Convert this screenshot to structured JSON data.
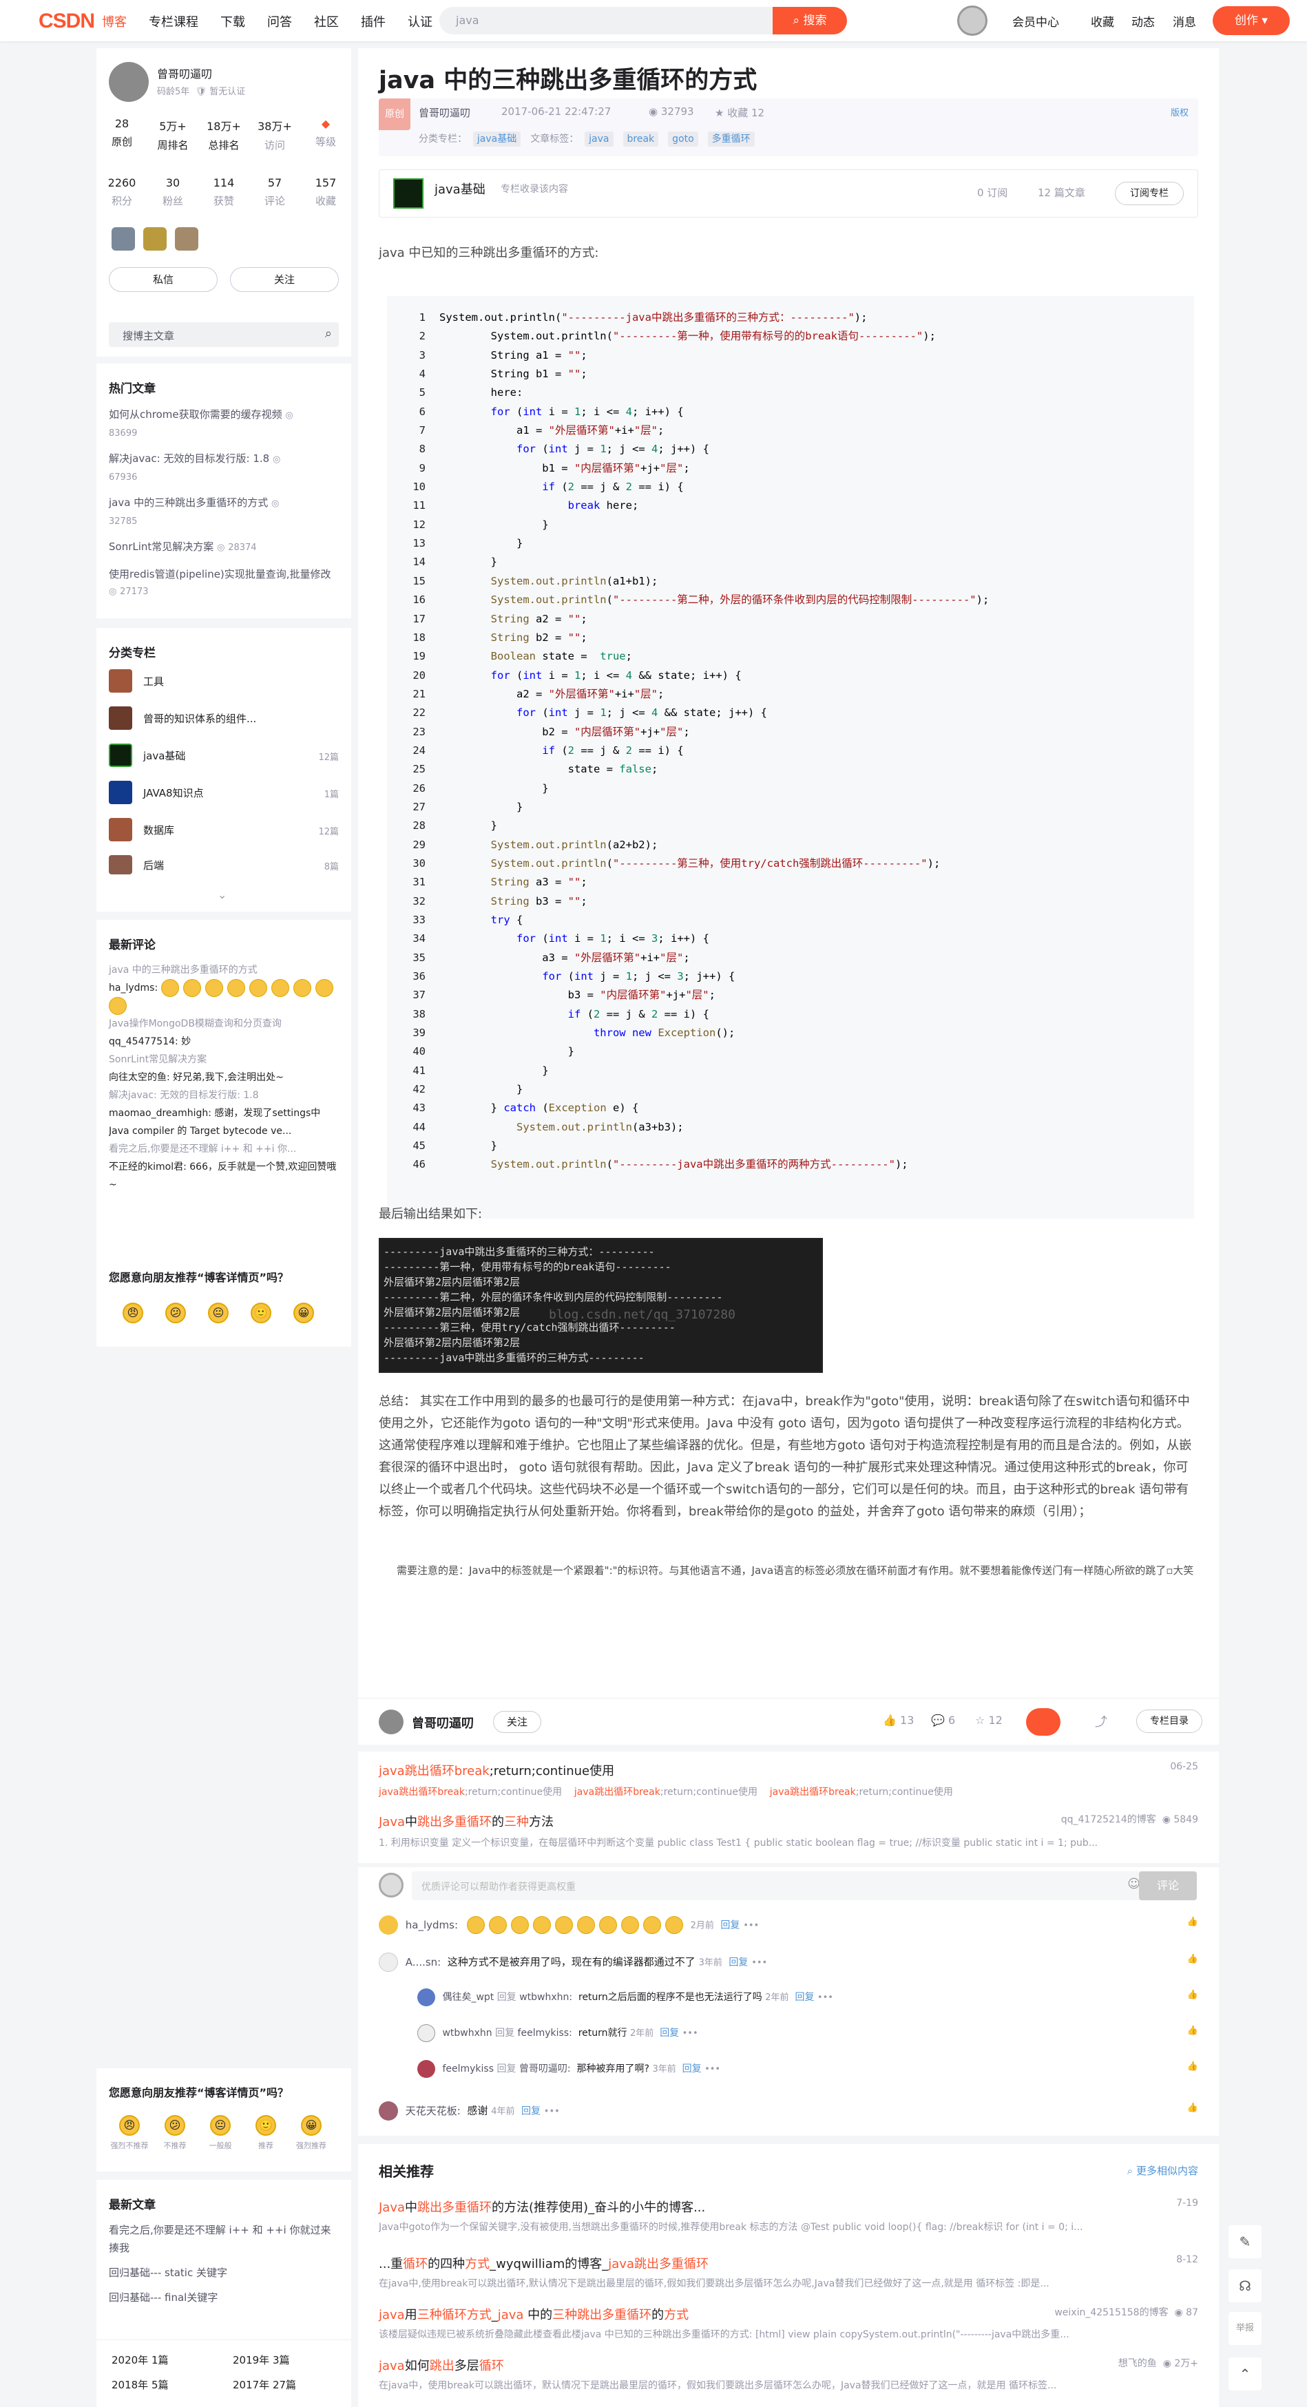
{
  "topbar": {
    "logo": "CSDN",
    "nav": [
      "博客",
      "专栏课程",
      "下载",
      "问答",
      "社区",
      "插件",
      "认证"
    ],
    "search_placeholder": "java",
    "search_button": "搜索",
    "right": [
      "会员中心",
      "收藏",
      "动态",
      "消息"
    ],
    "create_button": "创作"
  },
  "profile": {
    "name": "曾哥叨逼叨",
    "age": "码龄5年",
    "cert": "暂无认证",
    "stats1": [
      {
        "v": "28",
        "l": "原创"
      },
      {
        "v": "5万+",
        "l": "周排名"
      },
      {
        "v": "18万+",
        "l": "总排名"
      },
      {
        "v": "38万+",
        "l": "访问"
      },
      {
        "v": "",
        "l": "等级"
      }
    ],
    "stats2": [
      {
        "v": "2260",
        "l": "积分"
      },
      {
        "v": "30",
        "l": "粉丝"
      },
      {
        "v": "114",
        "l": "获赞"
      },
      {
        "v": "57",
        "l": "评论"
      },
      {
        "v": "157",
        "l": "收藏"
      }
    ],
    "msg_button": "私信",
    "follow_button": "关注",
    "search_placeholder": "搜博主文章"
  },
  "hot": {
    "title": "热门文章",
    "items": [
      {
        "t": "如何从chrome获取你需要的缓存视频",
        "v": "83699"
      },
      {
        "t": "解决javac: 无效的目标发行版: 1.8",
        "v": "67936"
      },
      {
        "t": "java 中的三种跳出多重循环的方式",
        "v": "32785"
      },
      {
        "t": "SonrLint常见解决方案",
        "v": "28374"
      },
      {
        "t": "使用redis管道(pipeline)实现批量查询,批量修改",
        "v": "27173"
      }
    ]
  },
  "categories": {
    "title": "分类专栏",
    "items": [
      {
        "n": "工具",
        "c": ""
      },
      {
        "n": "曾哥的知识体系的组件...",
        "c": ""
      },
      {
        "n": "java基础",
        "c": "12篇"
      },
      {
        "n": "JAVA8知识点",
        "c": "1篇"
      },
      {
        "n": "数据库",
        "c": "12篇"
      },
      {
        "n": "后端",
        "c": "8篇"
      }
    ]
  },
  "recent_comments": {
    "title": "最新评论",
    "items": [
      {
        "a": "java 中的三种跳出多重循环的方式",
        "b": "ha_lydms:"
      },
      {
        "a": "Java操作MongoDB模糊查询和分页查询",
        "b": "qq_45477514: 妙"
      },
      {
        "a": "SonrLint常见解决方案",
        "b": "向往太空的鱼: 好兄弟,我下,会注明出处~"
      },
      {
        "a": "解决javac: 无效的目标发行版: 1.8",
        "b": "maomao_dreamhigh: 感谢，发现了settings中Java compiler 的 Target bytecode ve..."
      },
      {
        "a": "看完之后,你要是还不理解 i++ 和 ++i 你...",
        "b": "不正经的kimol君: 666，反手就是一个赞,欢迎回赞哦~"
      }
    ]
  },
  "recommend_box": {
    "title": "您愿意向朋友推荐“博客详情页”吗？",
    "labels": [
      "强烈不推荐",
      "不推荐",
      "一般般",
      "推荐",
      "强烈推荐"
    ]
  },
  "recent_articles": {
    "title": "最新文章",
    "items": [
      "看完之后,你要是还不理解 i++ 和 ++i 你就过来揍我",
      "回归基础--- static 关键字",
      "回归基础--- final关键字"
    ],
    "archive": [
      {
        "y": "2020年",
        "n": "1篇"
      },
      {
        "y": "2019年",
        "n": "3篇"
      },
      {
        "y": "2018年",
        "n": "5篇"
      },
      {
        "y": "2017年",
        "n": "27篇"
      }
    ]
  },
  "article": {
    "title": "java 中的三种跳出多重循环的方式",
    "badge": "原创",
    "author": "曾哥叨逼叨",
    "date": "2017-06-21 22:47:27",
    "views": "32793",
    "fav": "收藏 12",
    "copyright": "版权",
    "cat_label": "分类专栏：",
    "cat": "java基础",
    "tag_label": "文章标签：",
    "tags": [
      "java",
      "break",
      "goto",
      "多重循环"
    ],
    "column_name": "java基础",
    "column_desc": "专栏收录该内容",
    "column_sub": "0 订阅",
    "column_count": "12 篇文章",
    "column_btn": "订阅专栏",
    "intro": "java 中已知的三种跳出多重循环的方式:",
    "output_label": "最后输出结果如下:",
    "console": [
      "---------java中跳出多重循环的三种方式：---------",
      "---------第一种，使用带有标号的的break语句---------",
      "外层循环第2层内层循环第2层",
      "---------第二种，外层的循环条件收到内层的代码控制限制---------",
      "外层循环第2层内层循环第2层",
      "---------第三种，使用try/catch强制跳出循环---------",
      "外层循环第2层内层循环第2层",
      "---------java中跳出多重循环的三种方式---------"
    ],
    "watermark": "blog.csdn.net/qq_37107280",
    "summary": "总结： 其实在工作中用到的最多的也最可行的是使用第一种方式：在java中，break作为\"goto\"使用，说明：break语句除了在switch语句和循环中使用之外，它还能作为goto 语句的一种\"文明\"形式来使用。Java 中没有 goto 语句，因为goto 语句提供了一种改变程序运行流程的非结构化方式。这通常使程序难以理解和难于维护。它也阻止了某些编译器的优化。但是，有些地方goto 语句对于构造流程控制是有用的而且是合法的。例如，从嵌套很深的循环中退出时， goto 语句就很有帮助。因此，Java 定义了break 语句的一种扩展形式来处理这种情况。通过使用这种形式的break，你可以终止一个或者几个代码块。这些代码块不必是一个循环或一个switch语句的一部分，它们可以是任何的块。而且，由于这种形式的break 语句带有标签，你可以明确指定执行从何处重新开始。你将看到，break带给你的是goto 的益处，并舍弃了goto 语句带来的麻烦（引用）；",
    "note": "需要注意的是：Java中的标签就是一个紧跟着\":\"的标识符。与其他语言不通，Java语言的标签必须放在循环前面才有作用。就不要想着能像传送门有一样随心所欲的跳了",
    "note_img_alt": "大笑"
  },
  "bottom_bar": {
    "author": "曾哥叨逼叨",
    "follow": "关注",
    "likes": "13",
    "comments": "6",
    "favs": "12",
    "column_btn": "专栏目录"
  },
  "related_top": [
    {
      "title": "java跳出循环break;return;continue使用",
      "date": "06-25",
      "desc": "java跳出循环break;return;continue使用 java跳出循环break;return;continue使用 java跳出循环break;return;continue使用"
    },
    {
      "title": "Java中跳出多重循环的三种方法",
      "author": "qq_41725214的博客",
      "views": "5849",
      "desc": "1. 利用标识变量 定义一个标识变量，在每层循环中判断这个变量 public class Test1 { public static boolean flag = true; //标识变量 public static int i = 1; pub..."
    }
  ],
  "comment_input": {
    "placeholder": "优质评论可以帮助作者获得更高权重",
    "btn": "评论"
  },
  "comments": [
    {
      "user": "ha_lydms:",
      "text": "",
      "time": "2月前",
      "reply": "回复"
    },
    {
      "user": "A....sn:",
      "text": "这种方式不是被弃用了吗，现在有的编译器都通过不了",
      "time": "3年前",
      "reply": "回复"
    },
    {
      "user": "偶往矣_wpt",
      "to": "wtbwhxhn:",
      "text": "return之后后面的程序不是也无法运行了吗",
      "time": "2年前",
      "reply": "回复"
    },
    {
      "user": "wtbwhxhn",
      "to": "feelmykiss:",
      "text": "return就行",
      "time": "2年前",
      "reply": "回复"
    },
    {
      "user": "feelmykiss",
      "to": "曾哥叨逼叨:",
      "text": "那种被弃用了啊?",
      "time": "3年前",
      "reply": "回复"
    },
    {
      "user": "天花天花板:",
      "text": "感谢",
      "time": "4年前",
      "reply": "回复"
    }
  ],
  "related": {
    "title": "相关推荐",
    "more": "更多相似内容",
    "items": [
      {
        "title": "Java中跳出多重循环的方法(推荐使用)_奋斗的小牛的博客...",
        "date": "7-19",
        "desc": "Java中goto作为一个保留关键字,没有被使用,当想跳出多重循环的时候,推荐使用break 标志的方法 @Test public void loop(){ flag: //break标识 for (int i = 0; i..."
      },
      {
        "title": "...重循环的四种方式_wyqwilliam的博客_java跳出多重循环",
        "date": "8-12",
        "desc": "在java中,使用break可以跳出循环,默认情况下是跳出最里层的循环,假如我们要跳出多层循环怎么办呢,Java替我们已经做好了这一点,就是用 循环标签 :即是..."
      },
      {
        "title": "java用三种循环方式_java 中的三种跳出多重循环的方式",
        "author": "weixin_42515158的博客",
        "views": "87",
        "desc": "该楼层疑似违规已被系统折叠隐藏此楼查看此楼java 中已知的三种跳出多重循环的方式: [html] view plain copySystem.out.println(\"---------java中跳出多重..."
      },
      {
        "title": "java如何跳出多层循环",
        "author": "想飞的鱼",
        "views": "2万+",
        "desc": "在java中，使用break可以跳出循环，默认情况下是跳出最里层的循环，假如我们要跳出多层循环怎么办呢，Java替我们已经做好了这一点，就是用 循环标签..."
      }
    ]
  },
  "float_right": {
    "report": "举报"
  }
}
